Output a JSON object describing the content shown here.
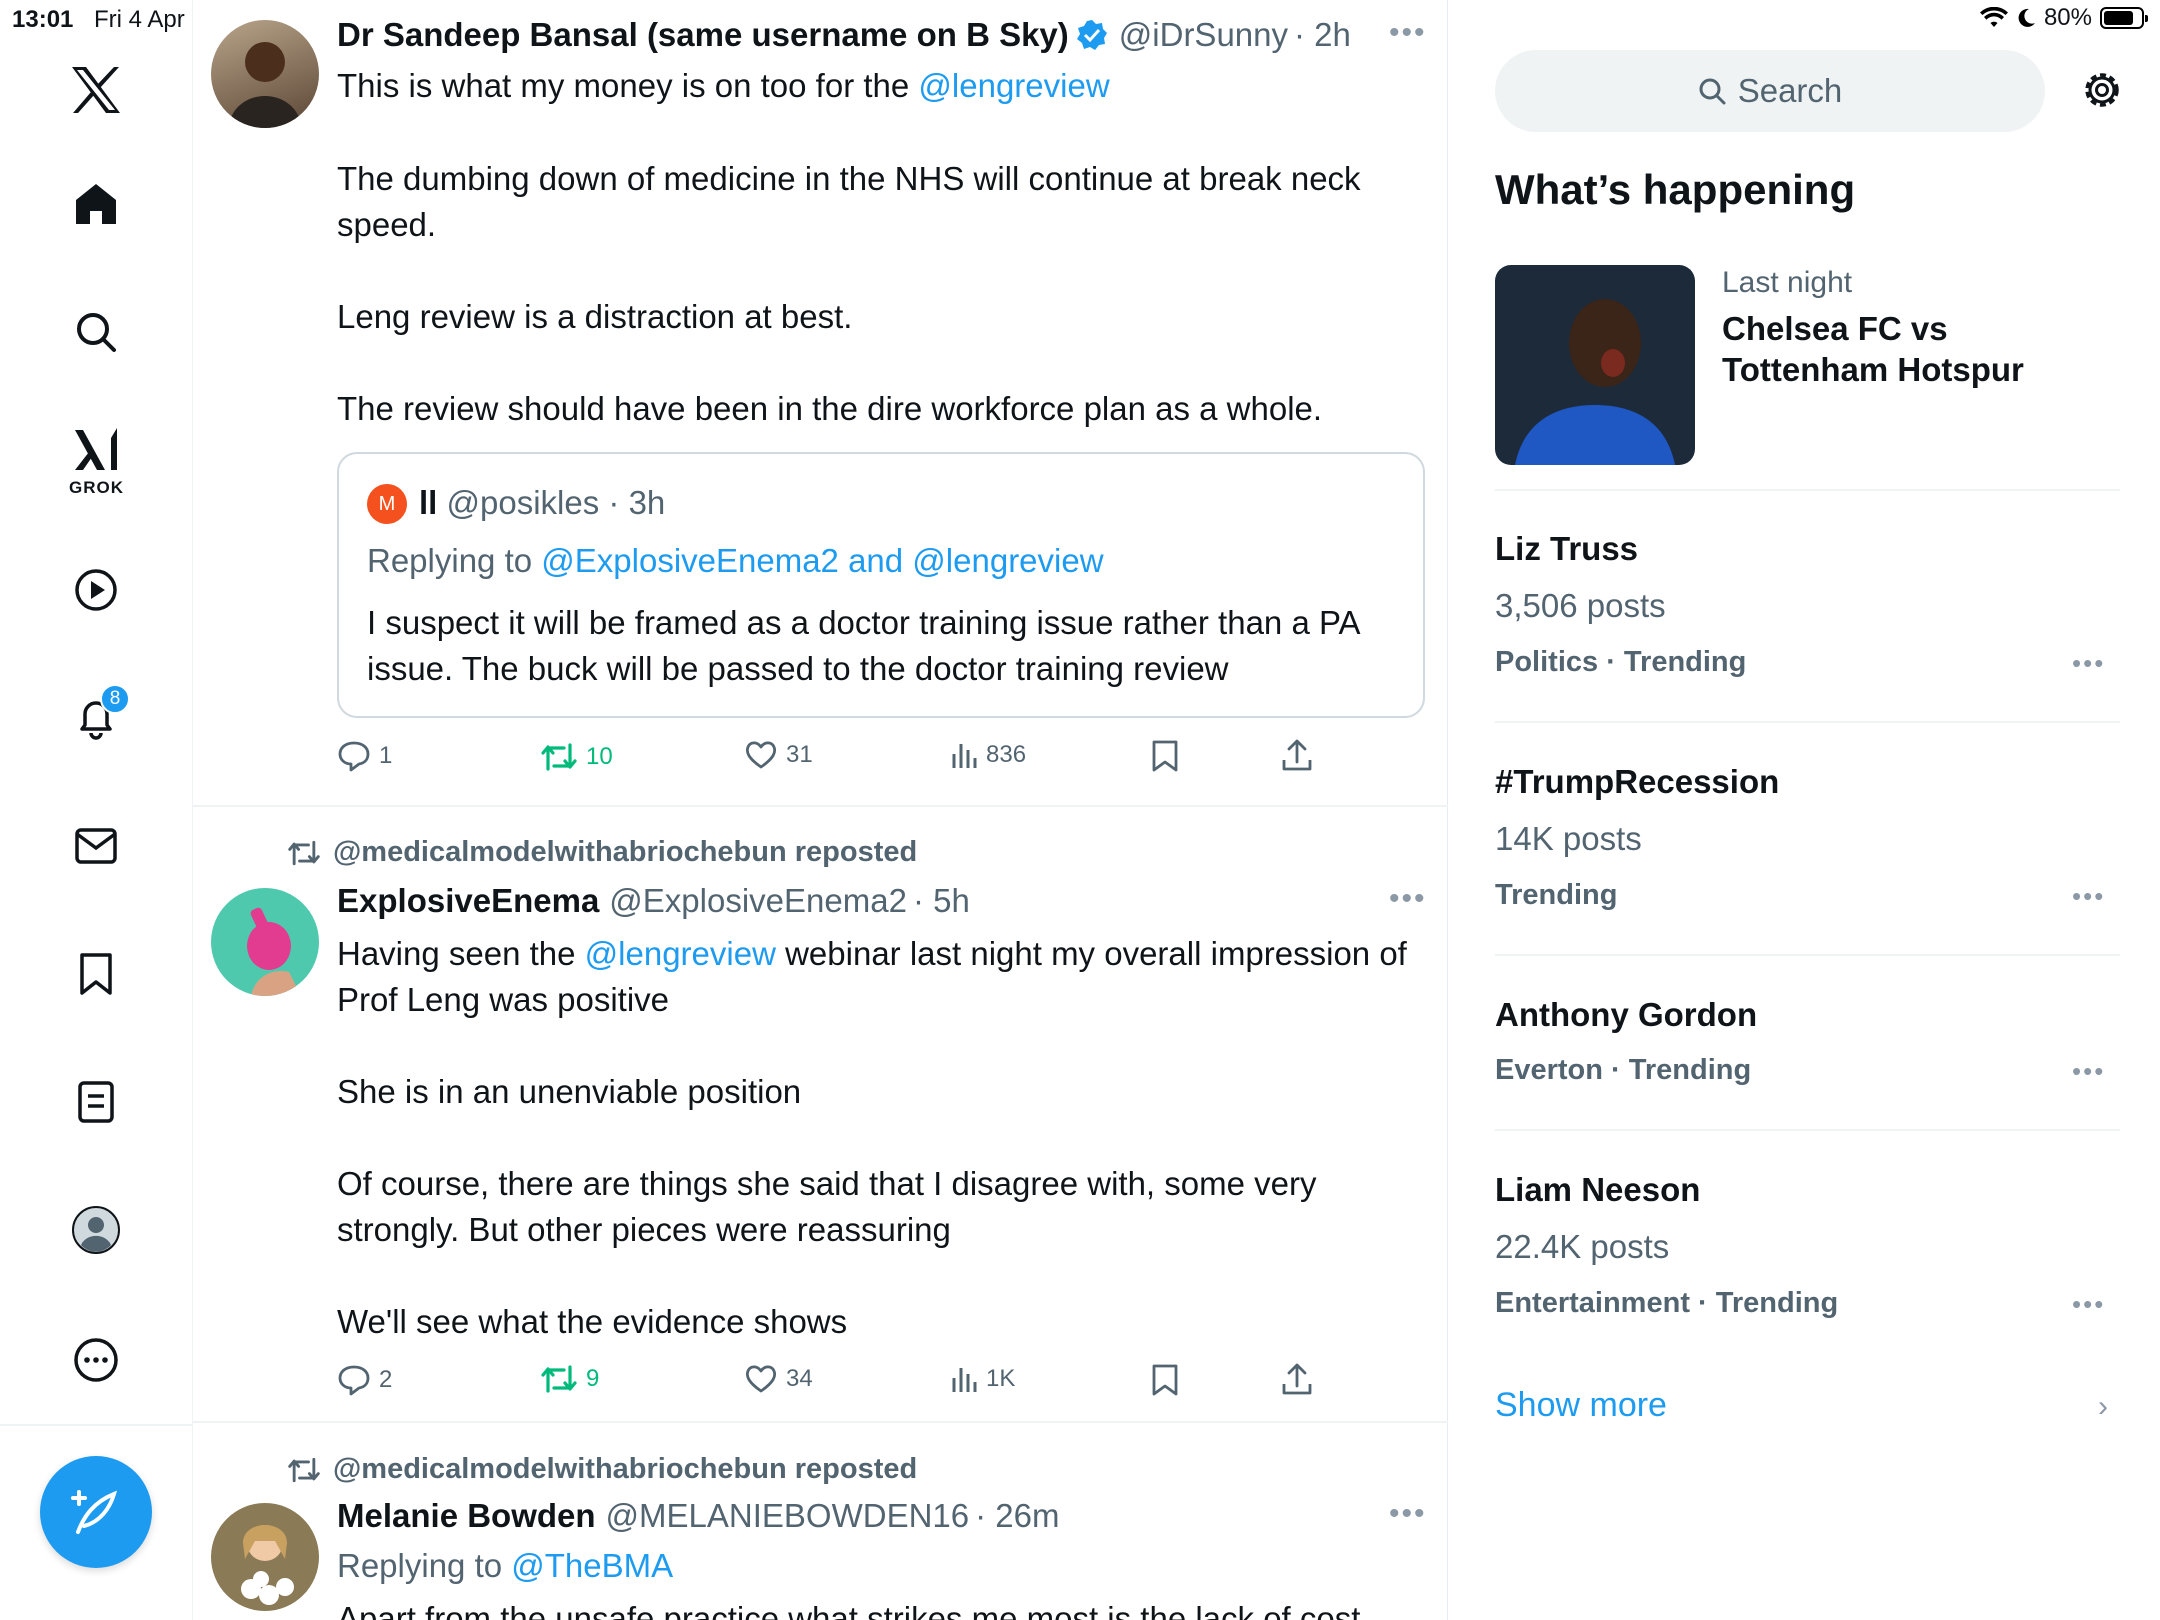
{
  "status_bar": {
    "time": "13:01",
    "date": "Fri 4 Apr",
    "battery": "80%",
    "battery_level": 0.8
  },
  "sidebar": {
    "logo": "x-logo",
    "items": [
      {
        "name": "home",
        "icon": "home-icon"
      },
      {
        "name": "explore",
        "icon": "search-icon"
      },
      {
        "name": "grok",
        "icon": "grok-icon",
        "label": "GROK"
      },
      {
        "name": "video",
        "icon": "play-icon"
      },
      {
        "name": "notifications",
        "icon": "bell-icon",
        "badge": "8"
      },
      {
        "name": "messages",
        "icon": "mail-icon"
      },
      {
        "name": "bookmarks",
        "icon": "bookmark-icon"
      },
      {
        "name": "lists",
        "icon": "list-icon"
      },
      {
        "name": "profile",
        "icon": "profile-icon"
      },
      {
        "name": "more",
        "icon": "more-icon"
      }
    ],
    "compose_icon": "compose-icon"
  },
  "posts": [
    {
      "author": "Dr Sandeep Bansal (same username on B Sky)",
      "verified": true,
      "handle": "@iDrSunny",
      "time": "· 2h",
      "text_pre": "This is what my money is on too for the ",
      "text_link": "@lengreview",
      "paragraphs": [
        "The dumbing down of medicine in the NHS will continue at break neck speed.",
        "Leng review is a distraction at best.",
        "The review should have been in the dire workforce plan as a whole."
      ],
      "quote": {
        "avatar_letter": "M",
        "name": "ll",
        "handle": "@posikles",
        "time": "· 3h",
        "replying_prefix": "Replying to ",
        "replying_to": "@ExplosiveEnema2 and @lengreview",
        "text": "I suspect it will be framed as a doctor training issue rather than a PA issue. The buck will be passed to the doctor training review"
      },
      "stats": {
        "replies": "1",
        "reposts": "10",
        "likes": "31",
        "views": "836"
      }
    },
    {
      "repost_by": "@medicalmodelwithabriochebun reposted",
      "author": "ExplosiveEnema",
      "handle": "@ExplosiveEnema2",
      "time": "· 5h",
      "text_pre": "Having seen the ",
      "text_link": "@lengreview",
      "text_post": " webinar last night my overall impression of Prof Leng was positive",
      "paragraphs": [
        "She is in an unenviable position",
        "Of course, there are things she said that I disagree with, some very strongly. But other pieces were reassuring",
        "We'll see what the evidence shows"
      ],
      "stats": {
        "replies": "2",
        "reposts": "9",
        "likes": "34",
        "views": "1K"
      }
    },
    {
      "repost_by": "@medicalmodelwithabriochebun reposted",
      "author": "Melanie Bowden",
      "handle": "@MELANIEBOWDEN16",
      "time": "· 26m",
      "replying_prefix": "Replying to ",
      "replying_to": "@TheBMA",
      "text": "Apart from the unsafe practice what strikes me most is the lack of cost"
    }
  ],
  "right": {
    "search_placeholder": "Search",
    "whats_happening": "What’s happening",
    "event": {
      "when": "Last night",
      "title": "Chelsea FC vs Tottenham Hotspur"
    },
    "trends": [
      {
        "name": "Liz Truss",
        "count": "3,506 posts",
        "category": "Politics · Trending"
      },
      {
        "name": "#TrumpRecession",
        "count": "14K posts",
        "category": "Trending"
      },
      {
        "name": "Anthony Gordon",
        "category": "Everton · Trending"
      },
      {
        "name": "Liam Neeson",
        "count": "22.4K posts",
        "category": "Entertainment · Trending"
      }
    ],
    "show_more": "Show more"
  },
  "colors": {
    "accent": "#1d9bf0",
    "repost": "#00ba7c",
    "muted": "#536471"
  }
}
